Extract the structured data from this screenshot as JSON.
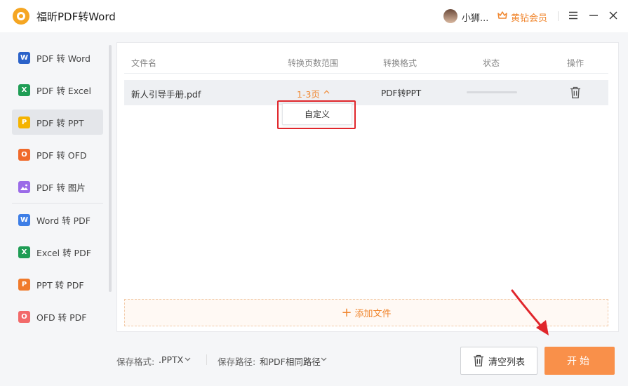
{
  "app": {
    "title": "福昕PDF转Word",
    "username": "小狮...",
    "vip_label": "黄钻会员"
  },
  "colors": {
    "accent": "#f0862e",
    "highlight": "#e0262b",
    "start_button": "#f9904a"
  },
  "sidebar": {
    "items": [
      {
        "label": "PDF 转 Word",
        "icon": "word-icon",
        "glyph": "W",
        "color": "#2b62c9"
      },
      {
        "label": "PDF 转 Excel",
        "icon": "excel-icon",
        "glyph": "X",
        "color": "#1f9d55"
      },
      {
        "label": "PDF 转 PPT",
        "icon": "ppt-icon",
        "glyph": "P",
        "color": "#f5b300",
        "active": true
      },
      {
        "label": "PDF 转 OFD",
        "icon": "ofd-icon",
        "glyph": "O",
        "color": "#f06a2b"
      },
      {
        "label": "PDF 转 图片",
        "icon": "image-icon",
        "glyph": "",
        "color": "#9b6be8"
      },
      {
        "label": "Word 转 PDF",
        "icon": "word-doc-icon",
        "glyph": "W",
        "color": "#3d7ee6"
      },
      {
        "label": "Excel 转 PDF",
        "icon": "excel-doc-icon",
        "glyph": "X",
        "color": "#1f9d55"
      },
      {
        "label": "PPT 转 PDF",
        "icon": "ppt-doc-icon",
        "glyph": "P",
        "color": "#f07a2b"
      },
      {
        "label": "OFD 转 PDF",
        "icon": "ofd-doc-icon",
        "glyph": "O",
        "color": "#f26a6a"
      }
    ]
  },
  "table": {
    "headers": {
      "filename": "文件名",
      "range": "转换页数范围",
      "format": "转换格式",
      "status": "状态",
      "action": "操作"
    },
    "rows": [
      {
        "filename": "新人引导手册.pdf",
        "range": "1-3页",
        "format": "PDF转PPT",
        "progress": 0
      }
    ],
    "dropdown_option": "自定义"
  },
  "add_file_label": "添加文件",
  "bottom": {
    "format_label": "保存格式:",
    "format_value": ".PPTX",
    "path_label": "保存路径:",
    "path_value": "和PDF相同路径",
    "clear_label": "清空列表",
    "start_label": "开始"
  }
}
